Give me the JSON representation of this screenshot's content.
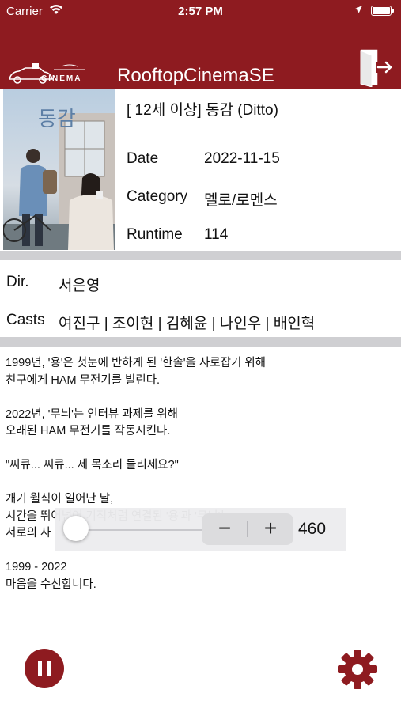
{
  "status_bar": {
    "carrier": "Carrier",
    "time": "2:57 PM"
  },
  "header": {
    "logo_text": "CINEMA",
    "title": "RooftopCinemaSE",
    "background_color": "#8e1b20"
  },
  "movie": {
    "title": "[ 12세 이상] 동감 (Ditto)",
    "poster_title": "동감",
    "info": [
      {
        "label": "Date",
        "value": "2022-11-15"
      },
      {
        "label": "Category",
        "value": "멜로/로멘스"
      },
      {
        "label": "Runtime",
        "value": "114"
      }
    ]
  },
  "credits": {
    "director_label": "Dir.",
    "director": "서은영",
    "casts_label": "Casts",
    "casts": "여진구 | 조이현 | 김혜윤 | 나인우 | 배인혁"
  },
  "synopsis": [
    "1999년, '용'은 첫눈에 반하게 된 '한솔'을 사로잡기 위해\n친구에게 HAM 무전기를 빌린다.",
    "2022년, '무늬'는 인터뷰 과제를 위해\n오래된 HAM 무전기를 작동시킨다.",
    "\"씨큐... 씨큐... 제 목소리 들리세요?\"",
    "개기 월식이 일어난 날,\n시간을 뛰어넘어 기적처럼 연결된 '용'과 '무늬'는\n서로의 사",
    "1999 - 2022\n마음을 수신합니다."
  ],
  "zoom_control": {
    "minus_label": "−",
    "plus_label": "+",
    "value": "460",
    "slider_level": 0.0
  },
  "icons": {
    "exit": "exit-door-icon",
    "pause": "pause-icon",
    "settings": "gear-icon"
  },
  "colors": {
    "accent": "#8e1b20",
    "divider": "#cfcfd2"
  }
}
